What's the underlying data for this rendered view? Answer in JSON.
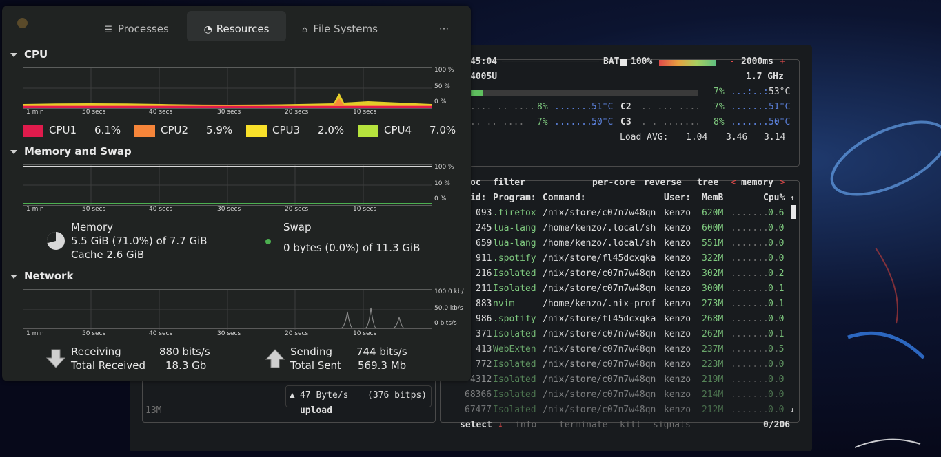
{
  "system_monitor": {
    "tabs": [
      {
        "label": "Processes",
        "icon": "list-icon"
      },
      {
        "label": "Resources",
        "icon": "gauge-icon"
      },
      {
        "label": "File Systems",
        "icon": "drive-icon"
      }
    ],
    "cpu": {
      "title": "CPU",
      "time_labels": [
        "1 min",
        "50 secs",
        "40 secs",
        "30 secs",
        "20 secs",
        "10 secs"
      ],
      "y_labels": [
        "100 %",
        "50 %",
        "0 %"
      ],
      "legend": [
        {
          "name": "CPU1",
          "value": "6.1%",
          "color": "#e01b4c"
        },
        {
          "name": "CPU2",
          "value": "5.9%",
          "color": "#f6853a"
        },
        {
          "name": "CPU3",
          "value": "2.0%",
          "color": "#f8e02a"
        },
        {
          "name": "CPU4",
          "value": "7.0%",
          "color": "#b6e33d"
        }
      ]
    },
    "memory": {
      "title": "Memory and Swap",
      "y_labels": [
        "100 %",
        "10 %",
        "0 %"
      ],
      "memory_label": "Memory",
      "memory_usage": "5.5 GiB (71.0%) of 7.7 GiB",
      "memory_cache": "Cache 2.6 GiB",
      "memory_fraction": 0.71,
      "swap_label": "Swap",
      "swap_usage": "0 bytes (0.0%) of 11.3 GiB"
    },
    "network": {
      "title": "Network",
      "y_labels": [
        "100.0 kb/",
        "50.0 kb/s",
        "0 bits/s"
      ],
      "receiving_label": "Receiving",
      "receiving_value": "880 bits/s",
      "total_received_label": "Total Received",
      "total_received_value": "18.3 Gb",
      "sending_label": "Sending",
      "sending_value": "744 bits/s",
      "total_sent_label": "Total Sent",
      "total_sent_value": "569.3 Mb"
    }
  },
  "btop": {
    "clock": "45:04",
    "battery_label": "BAT",
    "battery_pct": "100%",
    "refresh": "2000ms",
    "refresh_minus": "-",
    "refresh_plus": "+",
    "cpu_model": "4005U",
    "freq": "1.7 GHz",
    "cpu_total_pct": "7%",
    "cpu_total_temp": "53°C",
    "cores": [
      {
        "pct": "8%",
        "temp": "51°C"
      },
      {
        "name": "C2",
        "pct": "7%",
        "temp": "51°C"
      },
      {
        "pct": "7%",
        "temp": "50°C"
      },
      {
        "name": "C3",
        "pct": "8%",
        "temp": "50°C"
      }
    ],
    "load_label": "Load AVG:",
    "load": [
      "1.04",
      "3.46",
      "3.14"
    ],
    "proc_header": {
      "proc": "oc",
      "filter": "filter",
      "per_core": "per-core",
      "reverse": "reverse",
      "tree": "tree",
      "sort": "memory",
      "sort_left": "<",
      "sort_right": ">"
    },
    "columns": [
      "id:",
      "Program:",
      "Command:",
      "User:",
      "MemB",
      "Cpu%"
    ],
    "rows": [
      {
        "pid": "093",
        "program": ".firefox",
        "command": "/nix/store/c07n7w48qn",
        "user": "kenzo",
        "mem": "620M",
        "cpu": "0.6"
      },
      {
        "pid": "245",
        "program": "lua-lang",
        "command": "/home/kenzo/.local/sh",
        "user": "kenzo",
        "mem": "600M",
        "cpu": "0.0"
      },
      {
        "pid": "659",
        "program": "lua-lang",
        "command": "/home/kenzo/.local/sh",
        "user": "kenzo",
        "mem": "551M",
        "cpu": "0.0"
      },
      {
        "pid": "911",
        "program": ".spotify",
        "command": "/nix/store/fl45dcxqka",
        "user": "kenzo",
        "mem": "322M",
        "cpu": "0.0"
      },
      {
        "pid": "216",
        "program": "Isolated",
        "command": "/nix/store/c07n7w48qn",
        "user": "kenzo",
        "mem": "302M",
        "cpu": "0.2"
      },
      {
        "pid": "211",
        "program": "Isolated",
        "command": "/nix/store/c07n7w48qn",
        "user": "kenzo",
        "mem": "300M",
        "cpu": "0.1"
      },
      {
        "pid": "883",
        "program": "nvim",
        "command": "/home/kenzo/.nix-prof",
        "user": "kenzo",
        "mem": "273M",
        "cpu": "0.1"
      },
      {
        "pid": "986",
        "program": ".spotify",
        "command": "/nix/store/fl45dcxqka",
        "user": "kenzo",
        "mem": "268M",
        "cpu": "0.0"
      },
      {
        "pid": "371",
        "program": "Isolated",
        "command": "/nix/store/c07n7w48qn",
        "user": "kenzo",
        "mem": "262M",
        "cpu": "0.1"
      },
      {
        "pid": "413",
        "program": "WebExten",
        "command": "/nix/store/c07n7w48qn",
        "user": "kenzo",
        "mem": "237M",
        "cpu": "0.5"
      },
      {
        "pid": "772",
        "program": "Isolated",
        "command": "/nix/store/c07n7w48qn",
        "user": "kenzo",
        "mem": "223M",
        "cpu": "0.0"
      },
      {
        "pid": "4312",
        "program": "Isolated",
        "command": "/nix/store/c07n7w48qn",
        "user": "kenzo",
        "mem": "219M",
        "cpu": "0.0"
      },
      {
        "pid": "68366",
        "program": "Isolated",
        "command": "/nix/store/c07n7w48qn",
        "user": "kenzo",
        "mem": "214M",
        "cpu": "0.0"
      },
      {
        "pid": "67477",
        "program": "Isolated",
        "command": "/nix/store/c07n7w48qn",
        "user": "kenzo",
        "mem": "212M",
        "cpu": "0.0"
      }
    ],
    "footer": {
      "select": "select",
      "info": "info",
      "terminate": "terminate",
      "kill": "kill",
      "signals": "signals",
      "count": "0/206"
    },
    "net": {
      "upload_rate": "47 Byte/s",
      "upload_bits": "(376 bitps)",
      "upload_label": "upload",
      "scale": "13M"
    }
  }
}
